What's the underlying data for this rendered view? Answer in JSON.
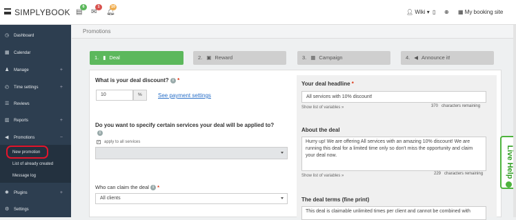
{
  "header": {
    "logo": "SIMPLYBOOK",
    "badges": {
      "tasks": "6",
      "mail": "1",
      "bell": "10"
    },
    "wiki": "Wiki",
    "booking_site": "My booking site"
  },
  "sidebar": {
    "items": [
      {
        "icon": "dashboard-icon",
        "label": "Dashboard",
        "plus": ""
      },
      {
        "icon": "calendar-icon",
        "label": "Calendar",
        "plus": ""
      },
      {
        "icon": "user-icon",
        "label": "Manage",
        "plus": "+"
      },
      {
        "icon": "clock-icon",
        "label": "Time settings",
        "plus": "+"
      },
      {
        "icon": "comments-icon",
        "label": "Reviews",
        "plus": ""
      },
      {
        "icon": "chart-icon",
        "label": "Reports",
        "plus": "+"
      },
      {
        "icon": "megaphone-icon",
        "label": "Promotions",
        "plus": "−"
      },
      {
        "icon": "puzzle-icon",
        "label": "Plugins",
        "plus": "+"
      },
      {
        "icon": "gears-icon",
        "label": "Settings",
        "plus": ""
      }
    ],
    "sub": [
      "New promotion",
      "List of already created",
      "Message log"
    ]
  },
  "crumb": "Promotions",
  "steps": [
    {
      "num": "1.",
      "label": "Deal",
      "active": true
    },
    {
      "num": "2.",
      "label": "Reward",
      "active": false
    },
    {
      "num": "3.",
      "label": "Campaign",
      "active": false
    },
    {
      "num": "4.",
      "label": "Announce it!",
      "active": false
    }
  ],
  "form": {
    "discount_label": "What is your deal discount?",
    "discount_value": "10",
    "discount_unit": "%",
    "payment_link": "See payment settings",
    "services_label": "Do you want to specify certain services your deal will be applied to?",
    "apply_all": "apply to all services",
    "who_label": "Who can claim the deal",
    "who_value": "All clients",
    "headline_label": "Your deal headline",
    "headline_value": "All services with 10% discount!",
    "show_vars": "Show list of variables »",
    "headline_remaining": "370",
    "remaining_text": "characters remaining",
    "about_label": "About the deal",
    "about_value": "Hurry up! We are offering All services with an amazing 10% discount! We are running this deal for a limited time only so don't miss the opportunity and claim your deal now.",
    "about_remaining": "229",
    "terms_label": "The deal terms (fine print)",
    "terms_value": "This deal is claimable unlimited times per client and cannot be combined with"
  },
  "live_help": "Live Help",
  "colors": {
    "sidebar": "#2d3e50",
    "active_step": "#5cb85c",
    "inactive_step": "#cfcfcf",
    "live_help": "#4db33d",
    "highlight": "#e5142b"
  }
}
